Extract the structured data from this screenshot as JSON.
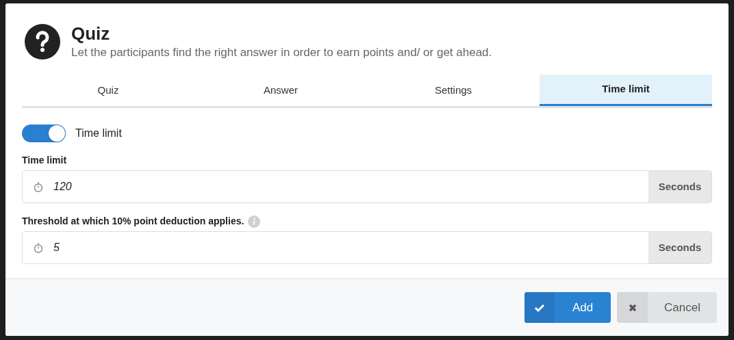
{
  "dialog": {
    "title": "Quiz",
    "subtitle": "Let the participants find the right answer in order to earn points and/ or get ahead."
  },
  "tabs": [
    {
      "label": "Quiz",
      "selected": false
    },
    {
      "label": "Answer",
      "selected": false
    },
    {
      "label": "Settings",
      "selected": false
    },
    {
      "label": "Time limit",
      "selected": true
    }
  ],
  "toggle": {
    "label": "Time limit",
    "on": true
  },
  "fields": [
    {
      "label": "Time limit",
      "value": "120",
      "unit": "Seconds",
      "info": false
    },
    {
      "label": "Threshold at which 10% point deduction applies.",
      "value": "5",
      "unit": "Seconds",
      "info": true
    }
  ],
  "buttons": [
    {
      "kind": "primary",
      "label": "Add"
    },
    {
      "kind": "secondary",
      "label": "Cancel"
    }
  ]
}
